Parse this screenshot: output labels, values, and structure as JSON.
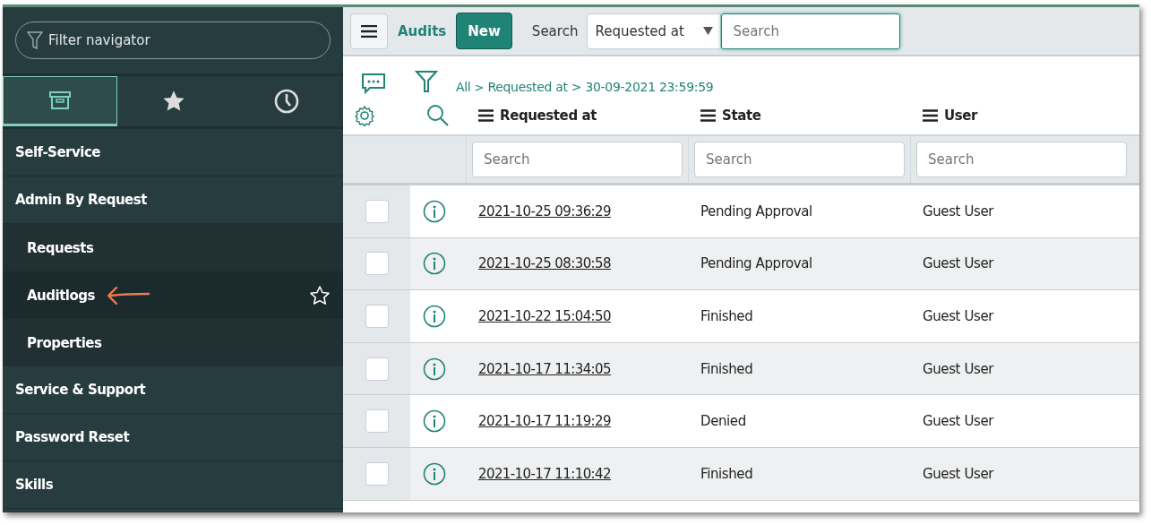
{
  "sidebar": {
    "filter": {
      "placeholder": "Filter navigator"
    },
    "tabs": [
      {
        "kind": "all",
        "selected": true
      },
      {
        "kind": "favorites",
        "selected": false
      },
      {
        "kind": "history",
        "selected": false
      }
    ],
    "items": [
      {
        "label": "Self-Service",
        "selected": false
      },
      {
        "label": "Admin By Request",
        "selected": false,
        "children": [
          {
            "label": "Requests",
            "selected": false
          },
          {
            "label": "Auditlogs",
            "selected": true,
            "favorite": false
          },
          {
            "label": "Properties",
            "selected": false
          }
        ]
      },
      {
        "label": "Service & Support",
        "selected": false
      },
      {
        "label": "Password Reset",
        "selected": false
      },
      {
        "label": "Skills",
        "selected": false
      }
    ]
  },
  "toolbar": {
    "title": "Audits",
    "new_button": "New",
    "search_label": "Search",
    "search_field": "Requested at",
    "search": {
      "placeholder": "Search"
    }
  },
  "breadcrumb": {
    "separator": ">",
    "items": [
      {
        "label": "All"
      },
      {
        "label": "Requested at > 30-09-2021 23:59:59"
      }
    ]
  },
  "table": {
    "columns": [
      {
        "label": "Requested at",
        "search_placeholder": "Search"
      },
      {
        "label": "State",
        "search_placeholder": "Search"
      },
      {
        "label": "User",
        "search_placeholder": "Search"
      }
    ],
    "rows": [
      {
        "checked": false,
        "requested_at": "2021-10-25 09:36:29",
        "state": "Pending Approval",
        "user": "Guest User"
      },
      {
        "checked": false,
        "requested_at": "2021-10-25 08:30:58",
        "state": "Pending Approval",
        "user": "Guest User"
      },
      {
        "checked": false,
        "requested_at": "2021-10-22 15:04:50",
        "state": "Finished",
        "user": "Guest User"
      },
      {
        "checked": false,
        "requested_at": "2021-10-17 11:34:05",
        "state": "Finished",
        "user": "Guest User"
      },
      {
        "checked": false,
        "requested_at": "2021-10-17 11:19:29",
        "state": "Denied",
        "user": "Guest User"
      },
      {
        "checked": false,
        "requested_at": "2021-10-17 11:10:42",
        "state": "Finished",
        "user": "Guest User"
      }
    ]
  }
}
